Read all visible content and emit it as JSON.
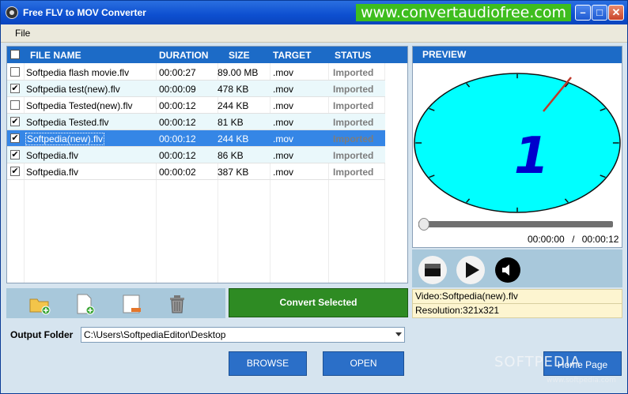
{
  "window": {
    "title": "Free FLV to MOV Converter",
    "promo": "www.convertaudiofree.com",
    "min_glyph": "–",
    "max_glyph": "□",
    "close_glyph": "✕"
  },
  "menu": {
    "file": "File"
  },
  "list": {
    "columns": {
      "file": "FILE NAME",
      "duration": "DURATION",
      "size": "SIZE",
      "target": "TARGET",
      "status": "STATUS"
    },
    "rows": [
      {
        "checked": false,
        "file": "Softpedia flash movie.flv",
        "duration": "00:00:27",
        "size": "89.00 MB",
        "target": ".mov",
        "status": "Imported"
      },
      {
        "checked": true,
        "file": "Softpedia test(new).flv",
        "duration": "00:00:09",
        "size": "478 KB",
        "target": ".mov",
        "status": "Imported"
      },
      {
        "checked": false,
        "file": "Softpedia Tested(new).flv",
        "duration": "00:00:12",
        "size": "244 KB",
        "target": ".mov",
        "status": "Imported"
      },
      {
        "checked": true,
        "file": "Softpedia Tested.flv",
        "duration": "00:00:12",
        "size": "81 KB",
        "target": ".mov",
        "status": "Imported"
      },
      {
        "checked": true,
        "file": "Softpedia(new).flv",
        "duration": "00:00:12",
        "size": "244 KB",
        "target": ".mov",
        "status": "Imported",
        "selected": true
      },
      {
        "checked": true,
        "file": "Softpedia.flv",
        "duration": "00:00:12",
        "size": "86 KB",
        "target": ".mov",
        "status": "Imported"
      },
      {
        "checked": true,
        "file": "Softpedia.flv",
        "duration": "00:00:02",
        "size": "387 KB",
        "target": ".mov",
        "status": "Imported"
      }
    ]
  },
  "toolbar": {
    "icons": [
      "add-folder-icon",
      "add-file-icon",
      "remove-file-icon",
      "trash-icon"
    ],
    "convert_label": "Convert Selected"
  },
  "output": {
    "label": "Output Folder",
    "path": "C:\\Users\\SoftpediaEditor\\Desktop",
    "browse_label": "BROWSE",
    "open_label": "OPEN",
    "home_label": "Home Page"
  },
  "preview": {
    "title": "PREVIEW",
    "current_time": "00:00:00",
    "separator": "/",
    "total_time": "00:00:12",
    "seek_fraction": 0,
    "video_info": "Video:Softpedia(new).flv",
    "resolution": "Resolution:321x321",
    "clock_face_color": "#00ffff",
    "clock_digit": "1"
  },
  "watermark": {
    "brand": "SOFTPEDIA",
    "url": "www.softpedia.com"
  },
  "colors": {
    "header_blue": "#1c6bc7",
    "convert_green": "#2e8b23",
    "selected_row": "#3586e6",
    "promo_green": "#3ebd1e"
  }
}
